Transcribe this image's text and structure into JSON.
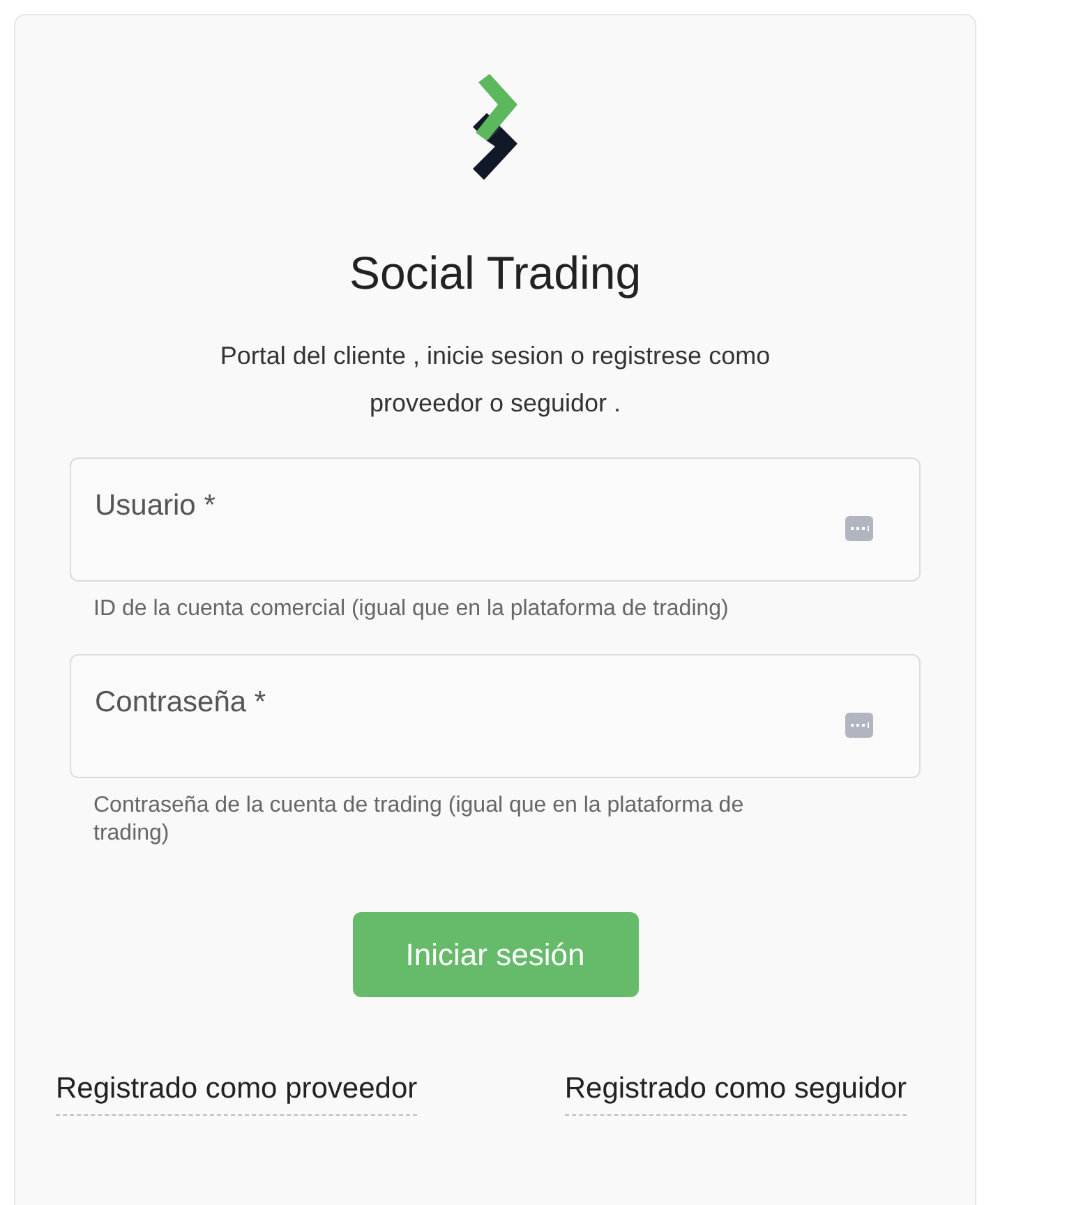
{
  "title": "Social Trading",
  "subtitle": "Portal del cliente , inicie sesion o registrese como proveedor o seguidor .",
  "fields": [
    {
      "placeholder": "Usuario *",
      "hint": "ID de la cuenta comercial (igual que en la plataforma de trading)"
    },
    {
      "placeholder": "Contraseña *",
      "hint": "Contraseña de la cuenta de trading (igual que en la plataforma de trading)"
    }
  ],
  "submit": "Iniciar sesión",
  "links": [
    "Registrado como proveedor",
    "Registrado como seguidor"
  ]
}
